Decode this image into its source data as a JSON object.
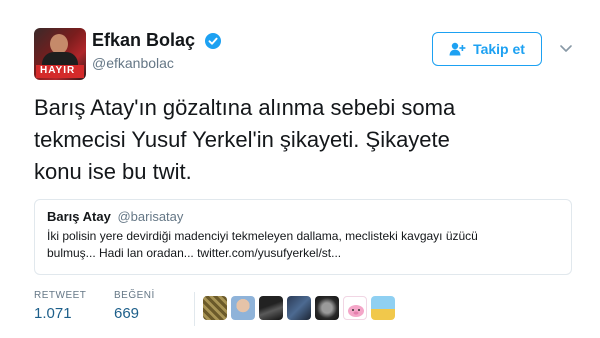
{
  "author": {
    "display_name": "Efkan Bolaç",
    "handle": "@efkanbolac",
    "avatar_banner_text": "HAYIR"
  },
  "follow_button": {
    "label": "Takip et",
    "icon": "add-user-icon"
  },
  "tweet": {
    "line1": "Barış Atay'ın gözaltına alınma sebebi soma",
    "line2": "tekmecisi Yusuf Yerkel'in şikayeti. Şikayete",
    "line3": "konu ise bu twit."
  },
  "quoted": {
    "display_name": "Barış Atay",
    "handle": "@barisatay",
    "line1": "İki polisin yere devirdiği madenciyi tekmeleyen dallama, meclisteki kavgayı üzücü",
    "line2": "bulmuş... Hadi lan oradan... twitter.com/yusufyerkel/st..."
  },
  "stats": {
    "retweet_label": "RETWEET",
    "retweet_count": "1.071",
    "likes_label": "BEĞENİ",
    "likes_count": "669"
  },
  "colors": {
    "accent": "#1da1f2",
    "count": "#1d5f8a",
    "muted": "#657786",
    "border": "#e1e8ed"
  }
}
